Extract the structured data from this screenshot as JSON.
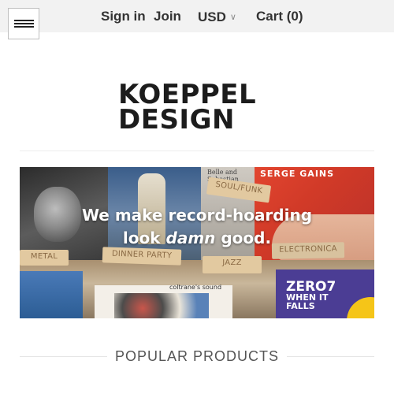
{
  "header": {
    "signin_label": "Sign in",
    "join_label": "Join",
    "currency": "USD",
    "cart_label": "Cart (0)"
  },
  "logo": {
    "line1": "KOEPPEL",
    "line2": "DESIGN"
  },
  "hero": {
    "headline_line1": "We make record-hoarding",
    "headline_line2_pre": "look ",
    "headline_line2_em": "damn",
    "headline_line2_post": " good.",
    "tabs": {
      "soul_funk": "SOUL/FUNK",
      "metal": "METAL",
      "dinner_party": "DINNER PARTY",
      "jazz": "JAZZ",
      "electronica": "ELECTRONICA"
    },
    "covers": {
      "serge": "SERGE GAINS",
      "belle": "Belle and Sebastian",
      "coltrane": "coltrane's sound",
      "zero7": "ZERO7",
      "when_it_falls": "WHEN IT FALLS"
    }
  },
  "section": {
    "title": "POPULAR PRODUCTS"
  },
  "icons": {
    "menu": "hamburger-menu-icon",
    "currency_dropdown": "chevron-down-icon"
  },
  "colors": {
    "topbar_bg": "#f2f2f2",
    "text_dark": "#222222",
    "hero_red": "#e2452f",
    "tab_tan": "#e2c9a0"
  }
}
